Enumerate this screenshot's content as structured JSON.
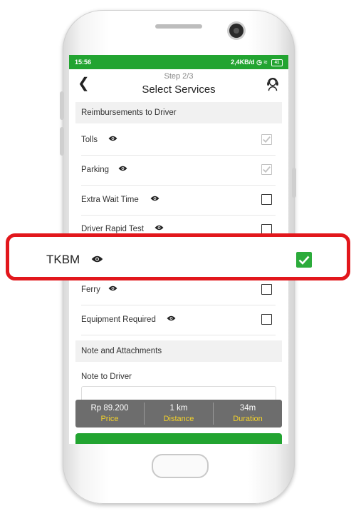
{
  "status_bar": {
    "time": "15:56",
    "network_speed": "2,4KB/d",
    "battery": "41"
  },
  "header": {
    "step": "Step 2/3",
    "title": "Select Services"
  },
  "reimbursements": {
    "title": "Reimbursements to Driver",
    "items": [
      {
        "label": "Tolls",
        "checked": true,
        "disabled": true
      },
      {
        "label": "Parking",
        "checked": true,
        "disabled": true
      },
      {
        "label": "Extra Wait Time",
        "checked": false
      },
      {
        "label": "Driver Rapid Test",
        "checked": false
      },
      {
        "label": "TKBM",
        "checked": true
      },
      {
        "label": "Ferry",
        "checked": false
      },
      {
        "label": "Equipment Required",
        "checked": false
      }
    ]
  },
  "notes": {
    "title": "Note and Attachments",
    "note_label": "Note to Driver"
  },
  "summary": {
    "price_value": "Rp 89.200",
    "price_label": "Price",
    "distance_value": "1 km",
    "distance_label": "Distance",
    "duration_value": "34m",
    "duration_label": "Duration"
  },
  "highlight": {
    "label": "TKBM",
    "checked": true
  },
  "colors": {
    "brand_green": "#22a431",
    "highlight_red": "#e2171c",
    "summary_label": "#f2d12b"
  }
}
